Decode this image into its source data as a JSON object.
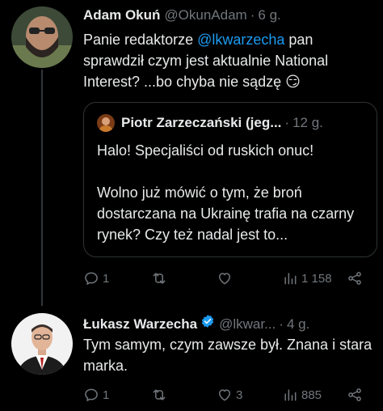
{
  "tweet1": {
    "name": "Adam Okuń",
    "handle": "@OkunAdam",
    "dot": "·",
    "time": "6 g.",
    "text_before": "Panie redaktorze ",
    "mention": "@lkwarzecha",
    "text_after": "  pan sprawdził czym jest aktualnie National Interest? ...bo chyba nie sądzę 😏",
    "quote": {
      "name": "Piotr Zarzeczański (jeg...",
      "dot": "·",
      "time": "12 g.",
      "line1": "Halo! Specjaliści od ruskich onuc!",
      "line2": "Wolno już mówić o tym, że broń dostarczana na Ukrainę trafia na czarny rynek? Czy też nadal jest to..."
    },
    "actions": {
      "reply": "1",
      "retweet": "",
      "like": "",
      "views": "1 158"
    }
  },
  "tweet2": {
    "name": "Łukasz Warzecha",
    "handle": "@lkwar...",
    "dot": "·",
    "time": "4 g.",
    "text": "Tym samym, czym zawsze był. Znana i stara marka.",
    "actions": {
      "reply": "1",
      "retweet": "",
      "like": "3",
      "views": "885"
    }
  },
  "colors": {
    "background": "#000000",
    "text": "#e7e9ea",
    "muted": "#71767b",
    "accent": "#1d9bf0",
    "border": "#2f3336"
  },
  "icons": [
    "reply-icon",
    "retweet-icon",
    "like-icon",
    "views-icon",
    "share-icon",
    "verified-badge-icon"
  ]
}
